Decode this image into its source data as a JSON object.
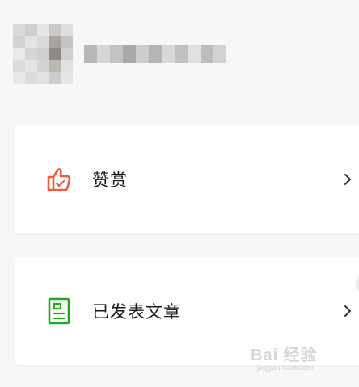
{
  "profile": {
    "avatar_alt": "avatar",
    "name": ""
  },
  "menu": [
    {
      "label": "赞赏",
      "icon": "thumbs-up-icon",
      "icon_color": "#f05a3a"
    },
    {
      "label": "已发表文章",
      "icon": "document-icon",
      "icon_color": "#1aad19"
    }
  ],
  "watermark": {
    "main": "Bai 经验",
    "sub": "jingyan.baidu.com"
  },
  "colors": {
    "background": "#f7f7f7",
    "card": "#ffffff",
    "text": "#1a1a1a",
    "chevron": "#333333"
  }
}
